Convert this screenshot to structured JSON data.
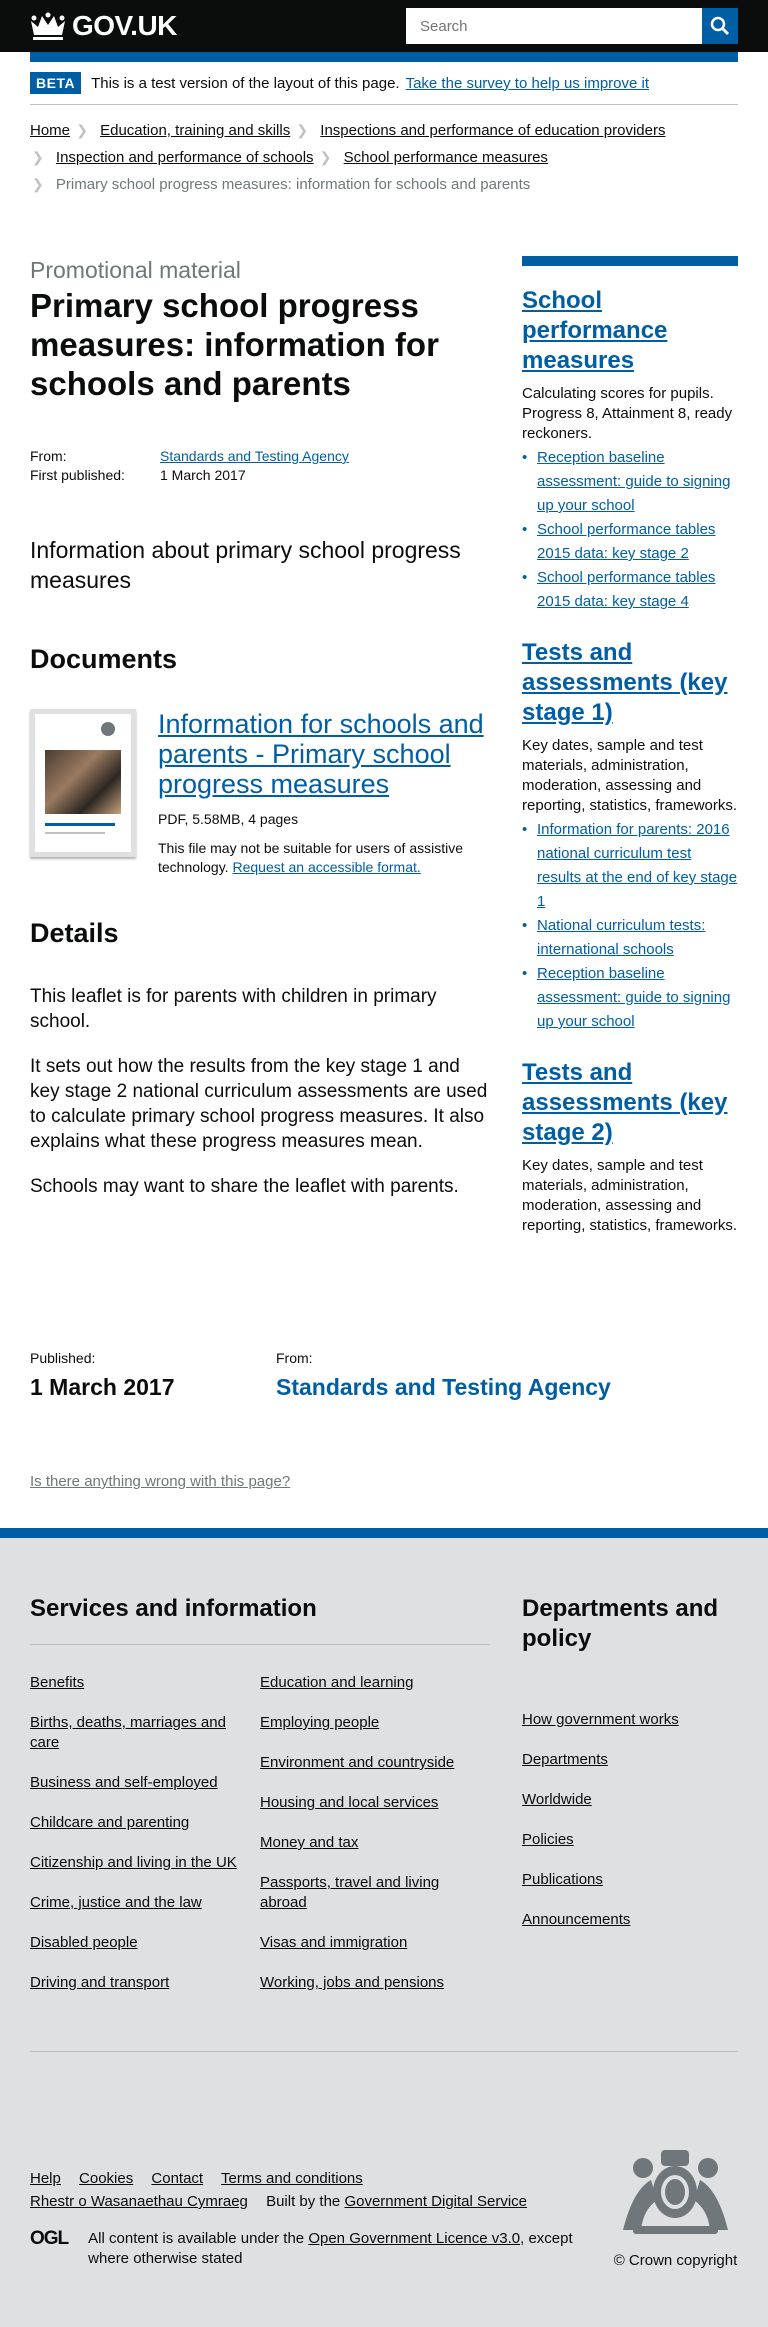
{
  "header": {
    "logo_text": "GOV.UK",
    "search_placeholder": "Search"
  },
  "beta": {
    "tag": "BETA",
    "text": "This is a test version of the layout of this page.",
    "link": "Take the survey to help us improve it"
  },
  "breadcrumbs": [
    "Home",
    "Education, training and skills",
    "Inspections and performance of education providers",
    "Inspection and performance of schools",
    "School performance measures",
    "Primary school progress measures: information for schools and parents"
  ],
  "page": {
    "format": "Promotional material",
    "title": "Primary school progress measures: information for schools and parents",
    "from_label": "From:",
    "from_value": "Standards and Testing Agency",
    "published_label": "First published:",
    "published_value": "1 March 2017",
    "lede": "Information about primary school progress measures"
  },
  "documents": {
    "heading": "Documents",
    "attachment": {
      "title": "Information for schools and parents - Primary school progress measures",
      "meta": "PDF, 5.58MB, 4 pages",
      "note": "This file may not be suitable for users of assistive technology.",
      "note_link": "Request an accessible format."
    }
  },
  "details": {
    "heading": "Details",
    "paragraphs": [
      "This leaflet is for parents with children in primary school.",
      "It sets out how the results from the key stage 1 and key stage 2 national curriculum assessments are used to calculate primary school progress measures. It also explains what these progress measures mean.",
      "Schools may want to share the leaflet with parents."
    ]
  },
  "sidebar": [
    {
      "title": "School performance measures",
      "desc": "Calculating scores for pupils. Progress 8, Attainment 8, ready reckoners.",
      "links": [
        "Reception baseline assessment: guide to signing up your school",
        "School performance tables 2015 data: key stage 2",
        "School performance tables 2015 data: key stage 4"
      ]
    },
    {
      "title": "Tests and assessments (key stage 1)",
      "desc": "Key dates, sample and test materials, administration, moderation, assessing and reporting, statistics, frameworks.",
      "links": [
        "Information for parents: 2016 national curriculum test results at the end of key stage 1",
        "National curriculum tests: international schools",
        "Reception baseline assessment: guide to signing up your school"
      ]
    },
    {
      "title": "Tests and assessments (key stage 2)",
      "desc": "Key dates, sample and test materials, administration, moderation, assessing and reporting, statistics, frameworks.",
      "links": []
    }
  ],
  "published": {
    "published_label": "Published:",
    "published_value": "1 March 2017",
    "from_label": "From:",
    "from_value": "Standards and Testing Agency"
  },
  "report_link": "Is there anything wrong with this page?",
  "footer": {
    "services_heading": "Services and information",
    "services_col1": [
      "Benefits",
      "Births, deaths, marriages and care",
      "Business and self-employed",
      "Childcare and parenting",
      "Citizenship and living in the UK",
      "Crime, justice and the law",
      "Disabled people",
      "Driving and transport"
    ],
    "services_col2": [
      "Education and learning",
      "Employing people",
      "Environment and countryside",
      "Housing and local services",
      "Money and tax",
      "Passports, travel and living abroad",
      "Visas and immigration",
      "Working, jobs and pensions"
    ],
    "departments_heading": "Departments and policy",
    "departments": [
      "How government works",
      "Departments",
      "Worldwide",
      "Policies",
      "Publications",
      "Announcements"
    ],
    "meta_links": [
      "Help",
      "Cookies",
      "Contact",
      "Terms and conditions",
      "Rhestr o Wasanaethau Cymraeg"
    ],
    "built_by": "Built by the",
    "built_by_link": "Government Digital Service",
    "ogl_logo": "OGL",
    "licence_pre": "All content is available under the",
    "licence_link": "Open Government Licence v3.0",
    "licence_post": ", except where otherwise stated",
    "copyright": "© Crown copyright"
  }
}
